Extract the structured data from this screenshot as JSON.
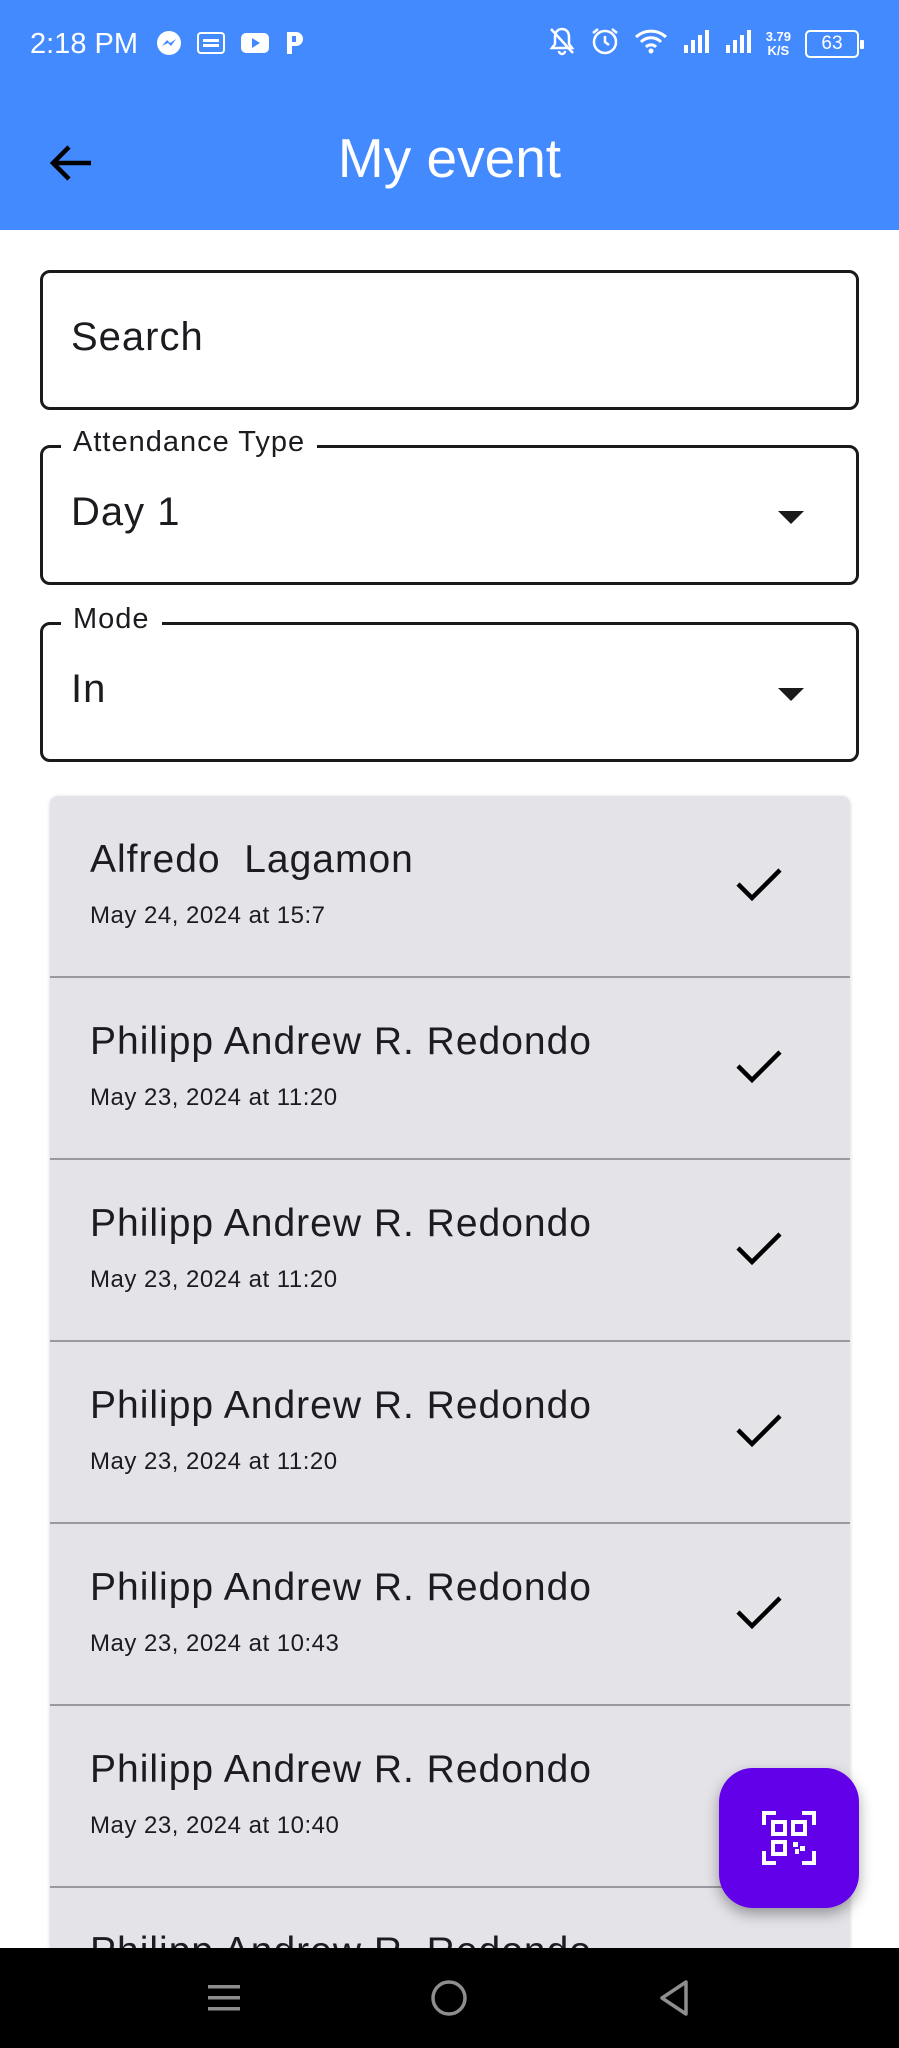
{
  "status_bar": {
    "time": "2:18 PM",
    "left_icons": [
      "messenger-icon",
      "temu-icon",
      "youtube-icon",
      "p-app-icon"
    ],
    "right_icons": [
      "bell-off-icon",
      "alarm-icon",
      "wifi-icon",
      "signal-icon",
      "signal-icon"
    ],
    "speed_value": "3.79",
    "speed_unit": "K/S",
    "battery": "63"
  },
  "app_bar": {
    "title": "My event",
    "back_icon": "arrow-left-icon",
    "background": "#448aff"
  },
  "search": {
    "placeholder": "Search"
  },
  "attendance_type": {
    "label": "Attendance Type",
    "value": "Day 1"
  },
  "mode": {
    "label": "Mode",
    "value": "In"
  },
  "attendees": [
    {
      "name": "Alfredo  Lagamon",
      "time": "May 24, 2024 at 15:7",
      "checked": true
    },
    {
      "name": "Philipp Andrew R. Redondo",
      "time": "May 23, 2024 at 11:20",
      "checked": true
    },
    {
      "name": "Philipp Andrew R. Redondo",
      "time": "May 23, 2024 at 11:20",
      "checked": true
    },
    {
      "name": "Philipp Andrew R. Redondo",
      "time": "May 23, 2024 at 11:20",
      "checked": true
    },
    {
      "name": "Philipp Andrew R. Redondo",
      "time": "May 23, 2024 at 10:43",
      "checked": true
    },
    {
      "name": "Philipp Andrew R. Redondo",
      "time": "May 23, 2024 at 10:40",
      "checked": true
    },
    {
      "name": "Philipp Andrew R. Redondo",
      "time": "",
      "checked": true
    }
  ],
  "fab": {
    "icon": "qr-code-scan-icon",
    "color": "#6200ea"
  },
  "nav_bar": {
    "icons": [
      "menu-icon",
      "home-circle-icon",
      "back-triangle-icon"
    ]
  }
}
